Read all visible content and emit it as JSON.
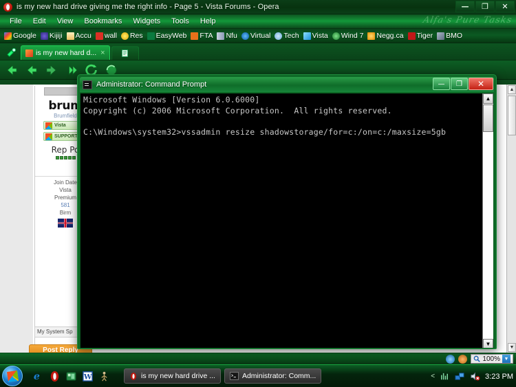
{
  "opera": {
    "title": "is my new hard drive giving me the right info - Page 5 - Vista Forums - Opera",
    "window_controls": {
      "minimize": "—",
      "restore": "❐",
      "close": "✕"
    },
    "menus": [
      "File",
      "Edit",
      "View",
      "Bookmarks",
      "Widgets",
      "Tools",
      "Help"
    ],
    "watermark": "Alfa's Pure Tasks",
    "bookmarks": [
      {
        "label": "Google",
        "color": "#4285f4"
      },
      {
        "label": "Kijiji",
        "color": "#4b3fa8"
      },
      {
        "label": "Accu",
        "color": "#f2d98a"
      },
      {
        "label": "wall",
        "color": "#d93025"
      },
      {
        "label": "Res",
        "color": "#f5d020"
      },
      {
        "label": "EasyWeb",
        "color": "#0a7a3f"
      },
      {
        "label": "FTA",
        "color": "#e8711a"
      },
      {
        "label": "Nfu",
        "color": "#c0c8d8"
      },
      {
        "label": "Virtual",
        "color": "#1a74c8"
      },
      {
        "label": "Tech",
        "color": "#8ab6e8"
      },
      {
        "label": "Vista",
        "color": "#5bb8f0"
      },
      {
        "label": "Wind 7",
        "color": "#2c8f3f"
      },
      {
        "label": "Negg.ca",
        "color": "#f0a020"
      },
      {
        "label": "Tiger",
        "color": "#c01818"
      },
      {
        "label": "BMO",
        "color": "#7b8fa8"
      }
    ],
    "tabs": [
      {
        "label": "is my new hard d...",
        "close": "×",
        "active": true
      }
    ],
    "nav_buttons": [
      "back",
      "forward",
      "rewind",
      "reload",
      "stop",
      "home"
    ],
    "statusbar": {
      "zoom": "100%",
      "zoom_caret": "▼"
    }
  },
  "page": {
    "username": "brum",
    "subtitle": "Brumfield",
    "badges": [
      {
        "text": "Vista"
      },
      {
        "text": "SUPPORT"
      }
    ],
    "rep_label": "Rep Po",
    "stats": [
      {
        "text": "Join Date"
      },
      {
        "text": "Vista"
      },
      {
        "text": "Premium"
      },
      {
        "text": "581",
        "link": true
      },
      {
        "text": "Birm"
      }
    ],
    "system_spec": "My System Sp",
    "post_reply": "Post Reply"
  },
  "cmd": {
    "title": "Administrator: Command Prompt",
    "window_controls": {
      "minimize": "—",
      "maximize": "❐",
      "close": "✕"
    },
    "console_text": "Microsoft Windows [Version 6.0.6000]\nCopyright (c) 2006 Microsoft Corporation.  All rights reserved.\n\nC:\\Windows\\system32>vssadmin resize shadowstorage/for=c:/on=c:/maxsize=5gb",
    "scroll_up": "▲",
    "scroll_down": "▼"
  },
  "taskbar": {
    "start": "start-orb",
    "quicklaunch": [
      "internet-explorer",
      "opera",
      "media-center",
      "word",
      "unknown-app"
    ],
    "items": [
      {
        "label": "is my new hard drive ...",
        "icon": "opera-icon"
      },
      {
        "label": "Administrator: Comm...",
        "icon": "console-icon"
      }
    ],
    "tray": {
      "caret": "<",
      "icons": [
        "network-activity",
        "network",
        "volume-muted"
      ],
      "clock": "3:23 PM"
    }
  }
}
